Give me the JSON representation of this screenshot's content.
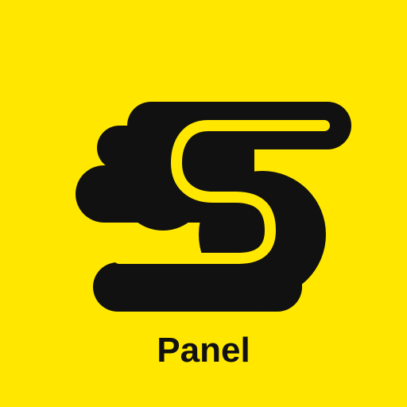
{
  "app": {
    "label": "Panel",
    "icon": "speed-s-logo-icon"
  },
  "colors": {
    "background": "#FFE700",
    "foreground": "#111111"
  }
}
